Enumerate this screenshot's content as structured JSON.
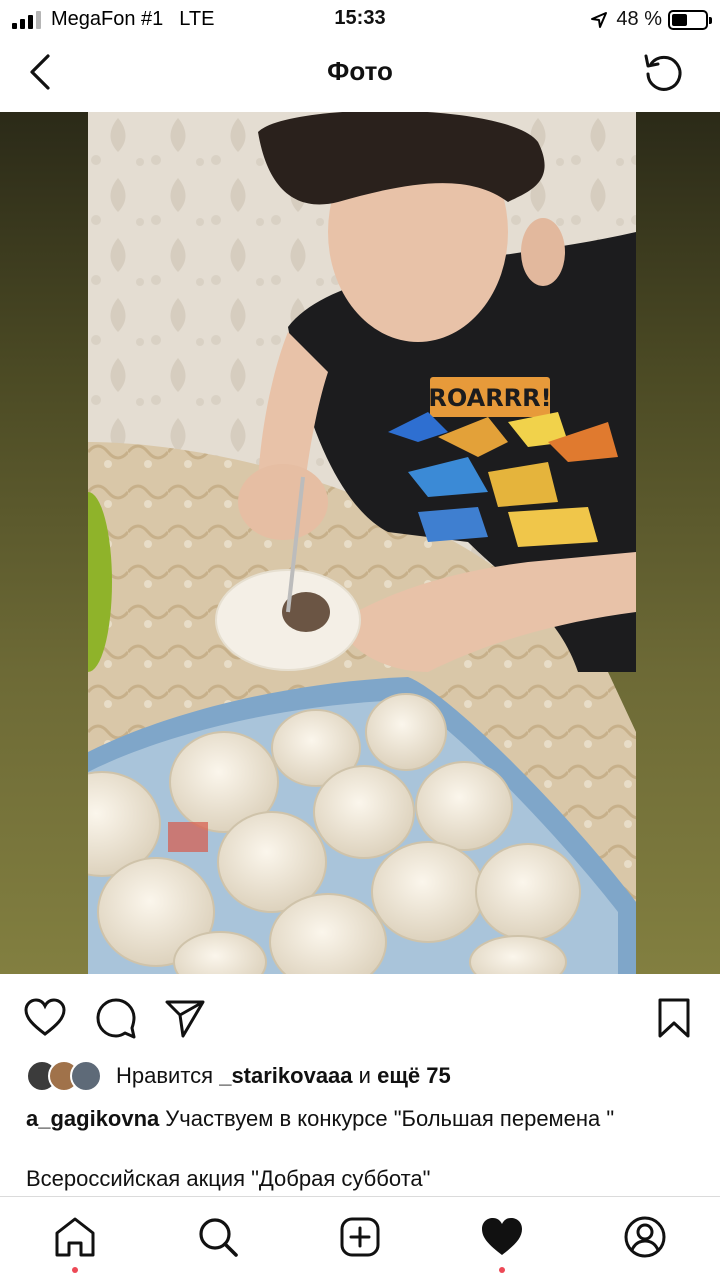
{
  "status_bar": {
    "carrier": "MegaFon #1",
    "network": "LTE",
    "time": "15:33",
    "battery": "48 %",
    "battery_level": 0.48,
    "signal_bars": 3
  },
  "header": {
    "title": "Фото",
    "back_icon": "chevron-left-icon",
    "refresh_icon": "refresh-icon"
  },
  "post": {
    "image_icon": "photo",
    "actions": {
      "like_icon": "heart-outline-icon",
      "comment_icon": "comment-icon",
      "share_icon": "send-icon",
      "save_icon": "bookmark-icon"
    },
    "likes": {
      "prefix": "Нравится",
      "user": "_starikovaaa",
      "connector": "и",
      "more": "ещё 75"
    },
    "caption_user": "a_gagikovna",
    "caption_text": "Участвуем в конкурсе \"Большая перемена \"",
    "caption_line2": "Всероссийская акция \"Добрая суббота\""
  },
  "tab_bar": {
    "home_icon": "home-icon",
    "search_icon": "search-icon",
    "create_icon": "plus-square-icon",
    "activity_icon": "heart-filled-icon",
    "profile_icon": "profile-icon"
  },
  "colors": {
    "notification_dot": "#ed4956",
    "text": "#111111",
    "divider": "#dbdbdb"
  }
}
